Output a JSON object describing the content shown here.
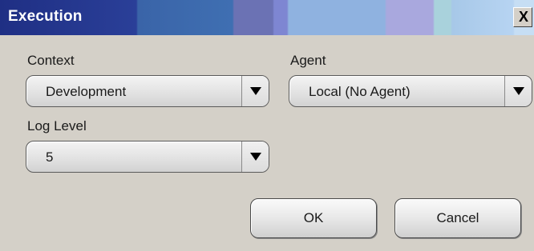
{
  "window": {
    "title": "Execution",
    "close_label": "X"
  },
  "form": {
    "context": {
      "label": "Context",
      "selected": "Development"
    },
    "agent": {
      "label": "Agent",
      "selected": "Local (No Agent)"
    },
    "log_level": {
      "label": "Log Level",
      "selected": "5"
    }
  },
  "buttons": {
    "ok_label": "OK",
    "cancel_label": "Cancel"
  },
  "icons": {
    "close": "close-icon",
    "dropdown": "chevron-down-icon"
  },
  "colors": {
    "title_text": "#ffffff",
    "window_bg": "#d4d0c8"
  }
}
